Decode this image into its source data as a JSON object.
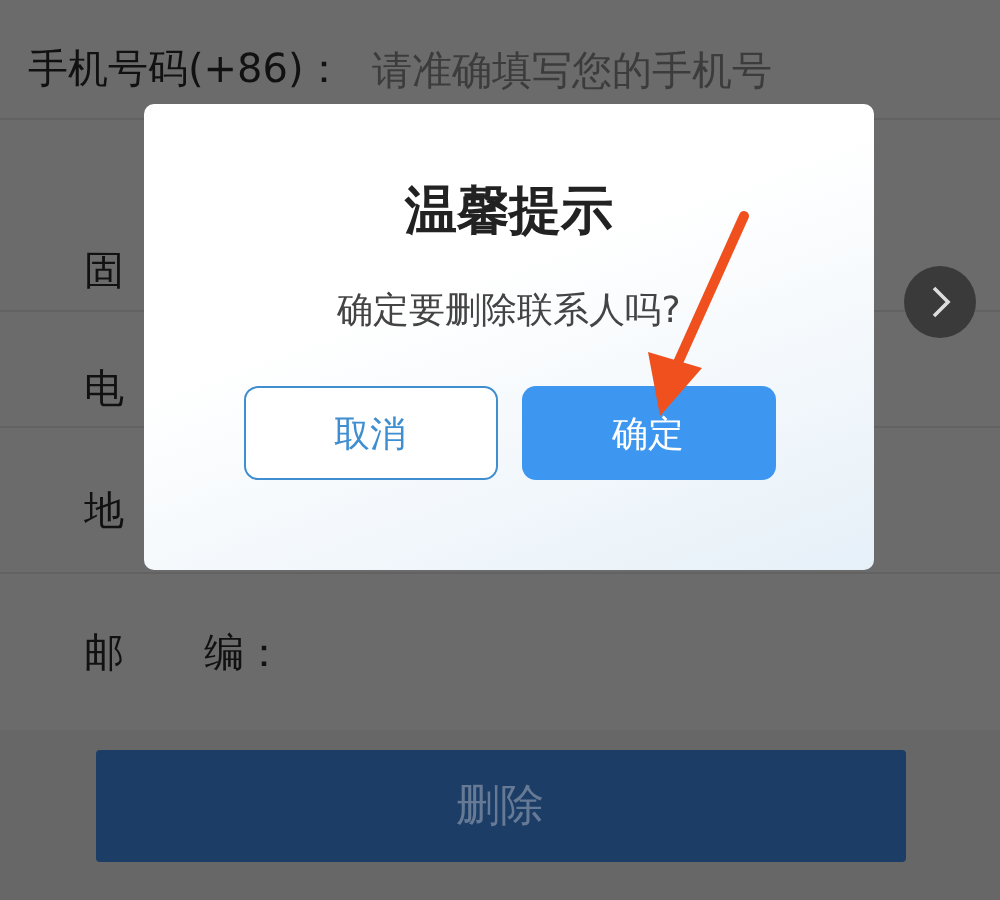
{
  "form": {
    "fields": [
      {
        "label": "手机号码(+86)：",
        "placeholder": "请准确填写您的手机号"
      },
      {
        "label": "固"
      },
      {
        "label": "电"
      },
      {
        "label": "地"
      },
      {
        "label": "邮　　编："
      }
    ]
  },
  "delete_button": "删除",
  "dialog": {
    "title": "温馨提示",
    "message": "确定要删除联系人吗?",
    "buttons": [
      {
        "label": "取消",
        "kind": "secondary"
      },
      {
        "label": "确定",
        "kind": "primary"
      }
    ]
  }
}
